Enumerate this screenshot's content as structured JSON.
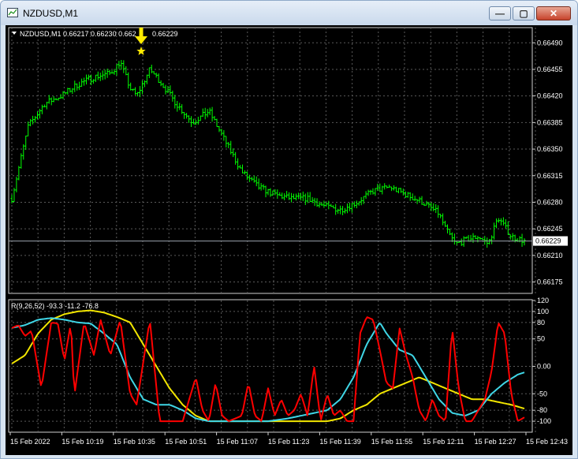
{
  "window": {
    "title": "NZDUSD,M1",
    "minimize_icon": "minimize-icon",
    "maximize_icon": "maximize-icon",
    "close_icon": "close-icon"
  },
  "main_chart": {
    "header": "NZDUSD,M1  0.66217 0.66230 0.662",
    "header_tail": "0.66229",
    "current_price_label": "0.66229",
    "price_axis": [
      "0.66490",
      "0.66455",
      "0.66420",
      "0.66385",
      "0.66350",
      "0.66315",
      "0.66280",
      "0.66245",
      "0.66210",
      "0.66175"
    ],
    "colors": {
      "candle": "#00ff00",
      "background": "#000000",
      "grid": "#5a5a5a",
      "marker": "#ffeb00"
    }
  },
  "indicator": {
    "header": "R(9,26,52) -93.3 -11.2 -76.8",
    "axis": [
      "120",
      "100",
      "80",
      "50",
      "0.00",
      "-50",
      "-80",
      "-100"
    ],
    "colors": {
      "fast": "#ff0000",
      "medium": "#3fd6e6",
      "slow": "#f2e600"
    }
  },
  "time_axis": [
    "15 Feb 2022",
    "15 Feb 10:19",
    "15 Feb 10:35",
    "15 Feb 10:51",
    "15 Feb 11:07",
    "15 Feb 11:23",
    "15 Feb 11:39",
    "15 Feb 11:55",
    "15 Feb 12:11",
    "15 Feb 12:27",
    "15 Feb 12:43"
  ],
  "chart_data": {
    "type": "line",
    "price": {
      "approx_close_path": [
        [
          0,
          0.66285
        ],
        [
          5,
          0.6638
        ],
        [
          10,
          0.6641
        ],
        [
          15,
          0.6642
        ],
        [
          20,
          0.66435
        ],
        [
          25,
          0.66445
        ],
        [
          30,
          0.6645
        ],
        [
          33,
          0.66465
        ],
        [
          36,
          0.6643
        ],
        [
          38,
          0.6642
        ],
        [
          42,
          0.66455
        ],
        [
          45,
          0.6644
        ],
        [
          50,
          0.6641
        ],
        [
          55,
          0.66385
        ],
        [
          60,
          0.664
        ],
        [
          65,
          0.6636
        ],
        [
          70,
          0.6632
        ],
        [
          75,
          0.663
        ],
        [
          80,
          0.6629
        ],
        [
          85,
          0.66285
        ],
        [
          90,
          0.66285
        ],
        [
          95,
          0.66275
        ],
        [
          100,
          0.6627
        ],
        [
          105,
          0.6628
        ],
        [
          110,
          0.66295
        ],
        [
          115,
          0.663
        ],
        [
          120,
          0.6629
        ],
        [
          125,
          0.6628
        ],
        [
          130,
          0.66265
        ],
        [
          132,
          0.66245
        ],
        [
          135,
          0.66225
        ],
        [
          138,
          0.6623
        ],
        [
          142,
          0.66235
        ],
        [
          145,
          0.66225
        ],
        [
          148,
          0.6626
        ],
        [
          152,
          0.66235
        ],
        [
          156,
          0.66229
        ]
      ],
      "current": 0.66229,
      "ylim": [
        0.6616,
        0.6651
      ]
    },
    "oscillator": {
      "ylim": [
        -120,
        120
      ],
      "fast": [
        [
          0,
          70
        ],
        [
          2,
          75
        ],
        [
          4,
          55
        ],
        [
          6,
          65
        ],
        [
          9,
          -40
        ],
        [
          12,
          80
        ],
        [
          14,
          78
        ],
        [
          16,
          10
        ],
        [
          18,
          80
        ],
        [
          19,
          -55
        ],
        [
          22,
          80
        ],
        [
          25,
          20
        ],
        [
          27,
          85
        ],
        [
          30,
          20
        ],
        [
          33,
          85
        ],
        [
          36,
          -50
        ],
        [
          38,
          -70
        ],
        [
          42,
          85
        ],
        [
          45,
          -100
        ],
        [
          48,
          -100
        ],
        [
          52,
          -100
        ],
        [
          56,
          -20
        ],
        [
          58,
          -80
        ],
        [
          60,
          -100
        ],
        [
          62,
          -30
        ],
        [
          64,
          -90
        ],
        [
          66,
          -100
        ],
        [
          70,
          -90
        ],
        [
          72,
          -30
        ],
        [
          74,
          -90
        ],
        [
          76,
          -100
        ],
        [
          78,
          -40
        ],
        [
          80,
          -90
        ],
        [
          82,
          -60
        ],
        [
          84,
          -90
        ],
        [
          86,
          -80
        ],
        [
          88,
          -50
        ],
        [
          90,
          -90
        ],
        [
          92,
          0
        ],
        [
          94,
          -100
        ],
        [
          96,
          -50
        ],
        [
          98,
          -90
        ],
        [
          100,
          -80
        ],
        [
          102,
          -100
        ],
        [
          104,
          -100
        ],
        [
          106,
          60
        ],
        [
          108,
          90
        ],
        [
          110,
          85
        ],
        [
          112,
          30
        ],
        [
          114,
          -30
        ],
        [
          116,
          -40
        ],
        [
          118,
          70
        ],
        [
          120,
          20
        ],
        [
          122,
          -20
        ],
        [
          124,
          -80
        ],
        [
          126,
          -100
        ],
        [
          128,
          -60
        ],
        [
          130,
          -90
        ],
        [
          132,
          -100
        ],
        [
          134,
          70
        ],
        [
          136,
          -40
        ],
        [
          138,
          -100
        ],
        [
          140,
          -100
        ],
        [
          142,
          -80
        ],
        [
          144,
          -60
        ],
        [
          146,
          -10
        ],
        [
          148,
          80
        ],
        [
          150,
          60
        ],
        [
          152,
          -50
        ],
        [
          154,
          -100
        ],
        [
          156,
          -93
        ]
      ],
      "medium": [
        [
          0,
          70
        ],
        [
          4,
          75
        ],
        [
          8,
          85
        ],
        [
          12,
          88
        ],
        [
          16,
          85
        ],
        [
          20,
          80
        ],
        [
          24,
          78
        ],
        [
          28,
          60
        ],
        [
          32,
          40
        ],
        [
          36,
          -20
        ],
        [
          40,
          -60
        ],
        [
          44,
          -70
        ],
        [
          48,
          -70
        ],
        [
          52,
          -80
        ],
        [
          56,
          -95
        ],
        [
          60,
          -100
        ],
        [
          66,
          -100
        ],
        [
          72,
          -100
        ],
        [
          78,
          -100
        ],
        [
          84,
          -95
        ],
        [
          88,
          -90
        ],
        [
          92,
          -85
        ],
        [
          96,
          -80
        ],
        [
          100,
          -60
        ],
        [
          104,
          -20
        ],
        [
          108,
          40
        ],
        [
          112,
          80
        ],
        [
          114,
          60
        ],
        [
          118,
          30
        ],
        [
          122,
          20
        ],
        [
          126,
          -20
        ],
        [
          130,
          -60
        ],
        [
          134,
          -85
        ],
        [
          138,
          -90
        ],
        [
          142,
          -80
        ],
        [
          146,
          -50
        ],
        [
          150,
          -30
        ],
        [
          154,
          -15
        ],
        [
          156,
          -11
        ]
      ],
      "slow": [
        [
          0,
          5
        ],
        [
          4,
          20
        ],
        [
          8,
          60
        ],
        [
          12,
          85
        ],
        [
          16,
          95
        ],
        [
          20,
          100
        ],
        [
          24,
          102
        ],
        [
          28,
          98
        ],
        [
          32,
          90
        ],
        [
          36,
          80
        ],
        [
          40,
          40
        ],
        [
          44,
          0
        ],
        [
          48,
          -40
        ],
        [
          52,
          -70
        ],
        [
          56,
          -90
        ],
        [
          60,
          -100
        ],
        [
          70,
          -100
        ],
        [
          80,
          -100
        ],
        [
          90,
          -100
        ],
        [
          96,
          -100
        ],
        [
          100,
          -95
        ],
        [
          104,
          -80
        ],
        [
          108,
          -70
        ],
        [
          112,
          -50
        ],
        [
          116,
          -40
        ],
        [
          120,
          -30
        ],
        [
          124,
          -20
        ],
        [
          128,
          -30
        ],
        [
          132,
          -40
        ],
        [
          136,
          -50
        ],
        [
          140,
          -60
        ],
        [
          144,
          -60
        ],
        [
          148,
          -65
        ],
        [
          152,
          -70
        ],
        [
          156,
          -77
        ]
      ]
    }
  }
}
